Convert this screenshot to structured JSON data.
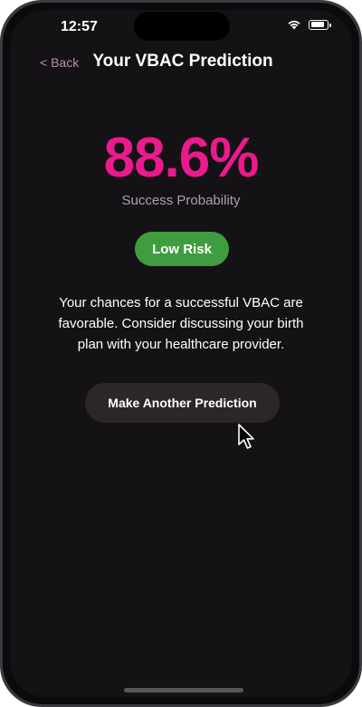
{
  "status_bar": {
    "time": "12:57"
  },
  "nav": {
    "back_label": "< Back",
    "title": "Your VBAC Prediction"
  },
  "result": {
    "percentage": "88.6%",
    "percentage_label": "Success Probability",
    "risk_label": "Low Risk",
    "advice": "Your chances for a successful VBAC are favorable. Consider discussing your birth plan with your healthcare provider."
  },
  "actions": {
    "predict_again_label": "Make Another Prediction"
  },
  "colors": {
    "accent_pink": "#ec1a8c",
    "risk_green": "#3f9d3f",
    "background": "#141215"
  }
}
